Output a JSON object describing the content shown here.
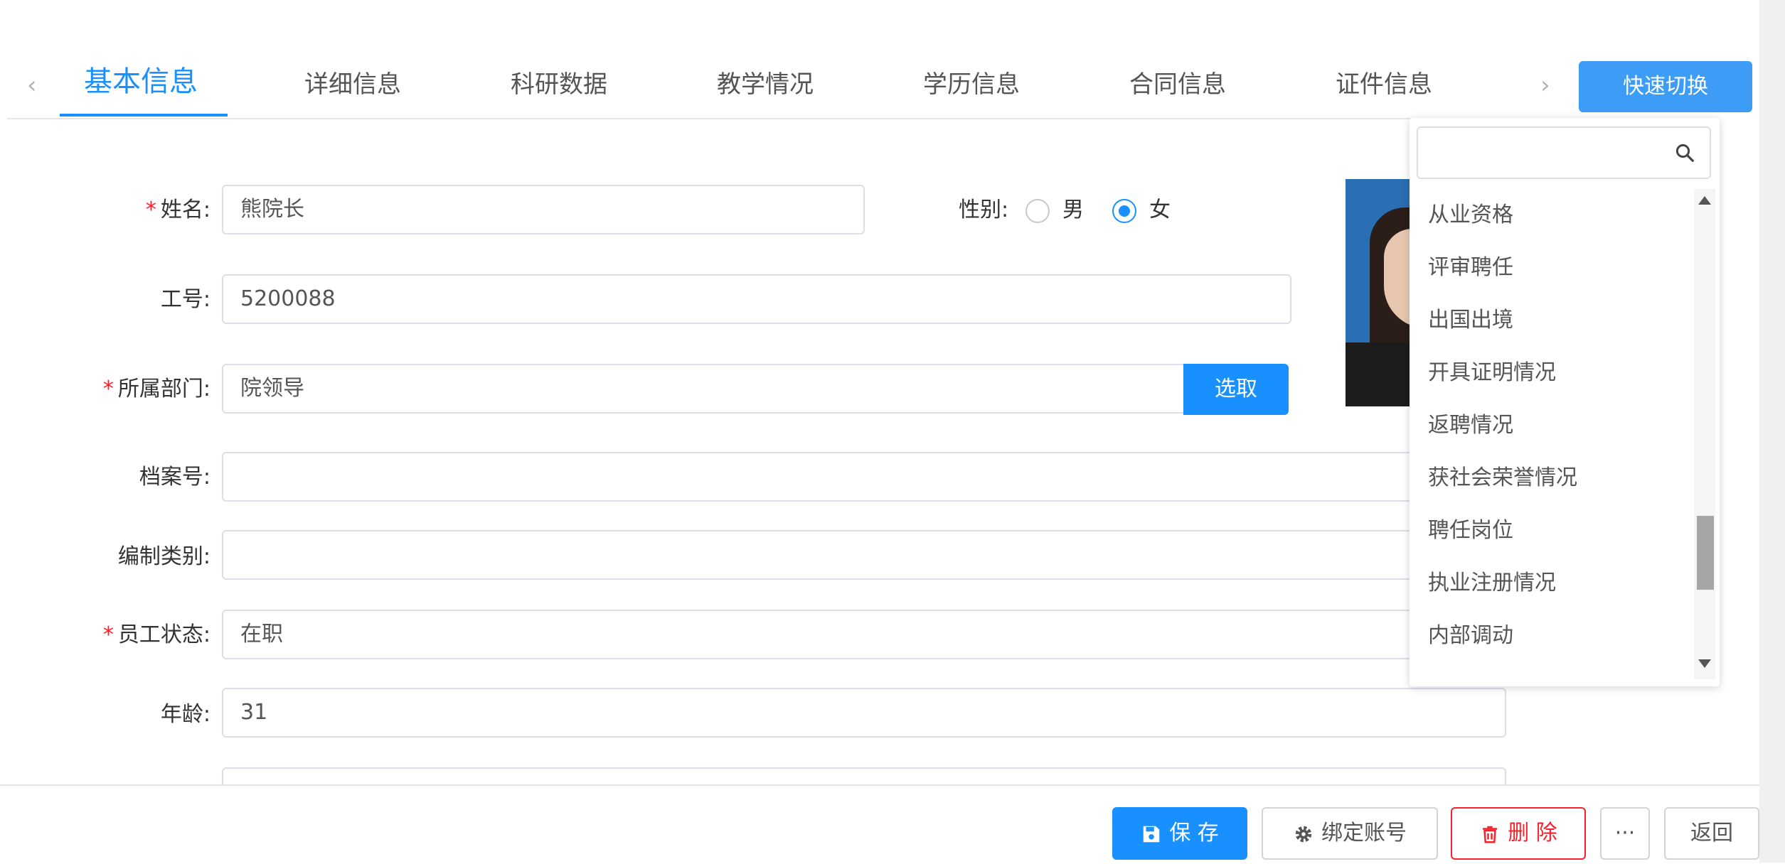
{
  "tabs": {
    "items": [
      {
        "label": "基本信息"
      },
      {
        "label": "详细信息"
      },
      {
        "label": "科研数据"
      },
      {
        "label": "教学情况"
      },
      {
        "label": "学历信息"
      },
      {
        "label": "合同信息"
      },
      {
        "label": "证件信息"
      }
    ],
    "prev_glyph": "‹",
    "next_glyph": "›",
    "quick_switch_label": "快速切换"
  },
  "form": {
    "name": {
      "label": "姓名:",
      "value": "熊院长",
      "required": "*"
    },
    "gender": {
      "label": "性别:",
      "options": [
        "男",
        "女"
      ],
      "selected": "女"
    },
    "employee_no": {
      "label": "工号:",
      "value": "5200088"
    },
    "department": {
      "label": "所属部门:",
      "value": "院领导",
      "required": "*",
      "pick_label": "选取"
    },
    "archive_no": {
      "label": "档案号:",
      "value": ""
    },
    "staffing_type": {
      "label": "编制类别:",
      "value": ""
    },
    "status": {
      "label": "员工状态:",
      "value": "在职",
      "required": "*"
    },
    "age": {
      "label": "年龄:",
      "value": "31"
    }
  },
  "dropdown": {
    "search_placeholder": "",
    "items": [
      "从业资格",
      "评审聘任",
      "出国出境",
      "开具证明情况",
      "返聘情况",
      "获社会荣誉情况",
      "聘任岗位",
      "执业注册情况",
      "内部调动"
    ]
  },
  "footer": {
    "save_label": "保 存",
    "bind_label": "绑定账号",
    "delete_label": "删 除",
    "more_label": "···",
    "back_label": "返回"
  },
  "colors": {
    "accent": "#1890ff",
    "danger": "#f5222d"
  }
}
